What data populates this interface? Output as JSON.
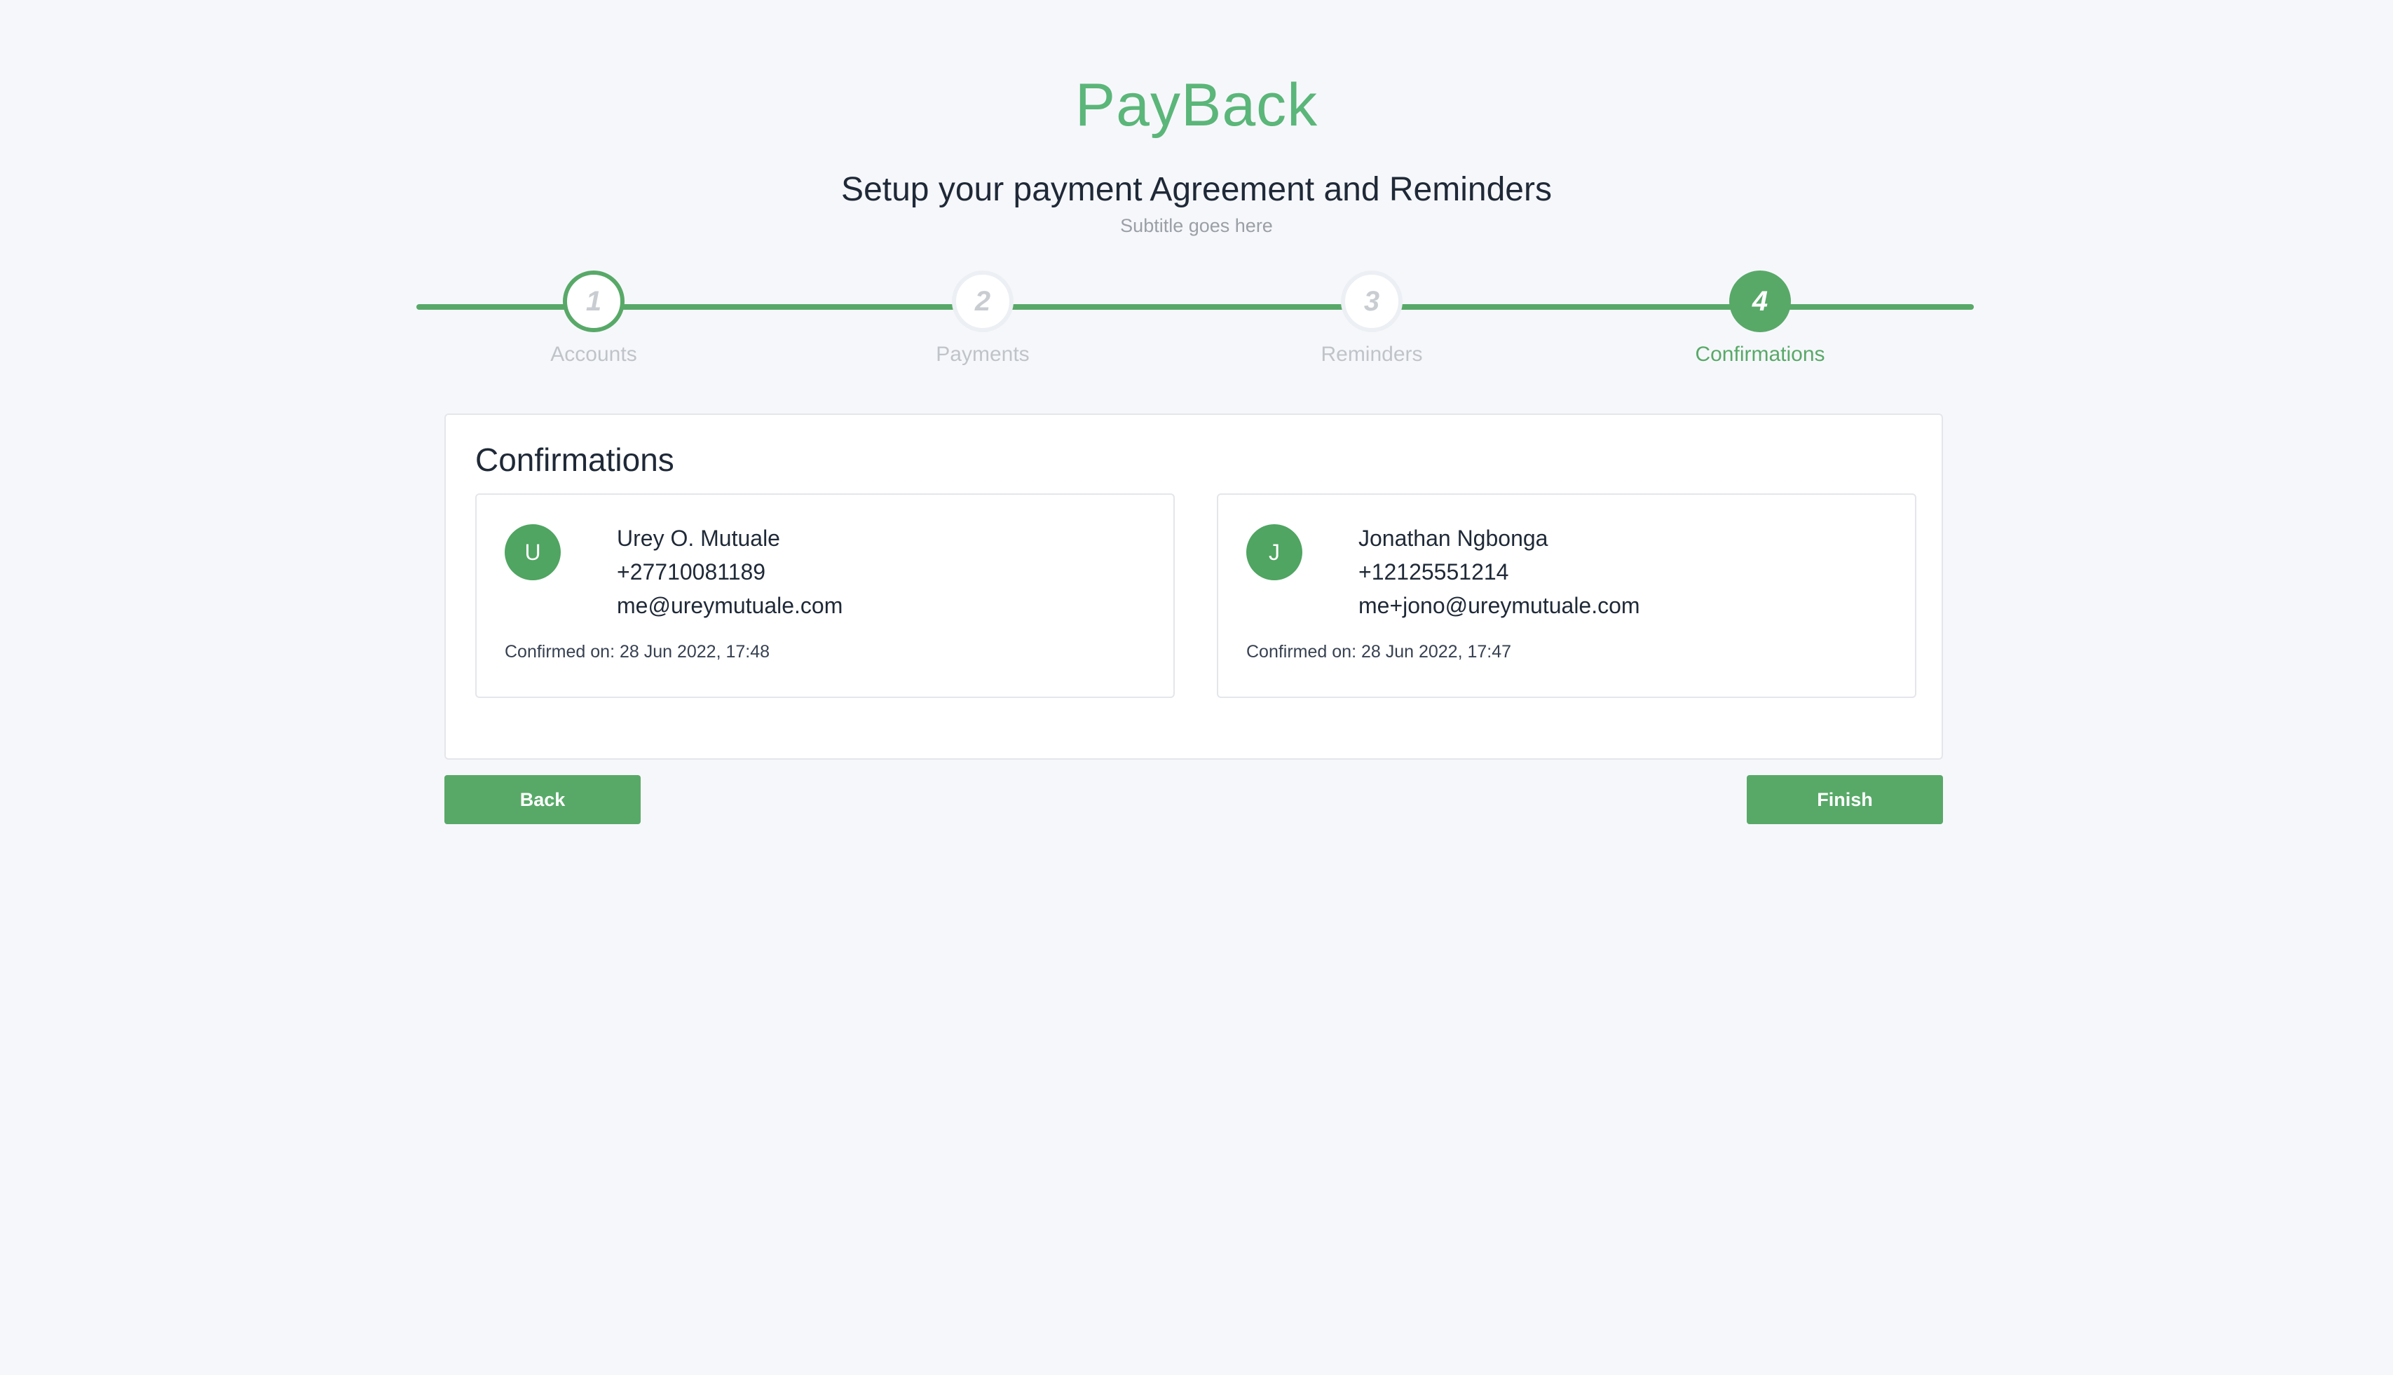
{
  "header": {
    "brand": "PayBack",
    "title": "Setup your payment Agreement and Reminders",
    "subtitle": "Subtitle goes here"
  },
  "stepper": {
    "steps": [
      {
        "number": "1",
        "label": "Accounts",
        "state": "done"
      },
      {
        "number": "2",
        "label": "Payments",
        "state": "pending"
      },
      {
        "number": "3",
        "label": "Reminders",
        "state": "pending"
      },
      {
        "number": "4",
        "label": "Confirmations",
        "state": "active"
      }
    ]
  },
  "confirmations": {
    "title": "Confirmations",
    "contacts": [
      {
        "initial": "U",
        "name": "Urey O. Mutuale",
        "phone": "+27710081189",
        "email": "me@ureymutuale.com",
        "confirmed": "Confirmed on: 28 Jun 2022, 17:48"
      },
      {
        "initial": "J",
        "name": "Jonathan Ngbonga",
        "phone": "+12125551214",
        "email": "me+jono@ureymutuale.com",
        "confirmed": "Confirmed on: 28 Jun 2022, 17:47"
      }
    ]
  },
  "actions": {
    "back_label": "Back",
    "finish_label": "Finish"
  },
  "colors": {
    "accent": "#58a968",
    "brand": "#5bb679",
    "background": "#f6f7fb"
  }
}
